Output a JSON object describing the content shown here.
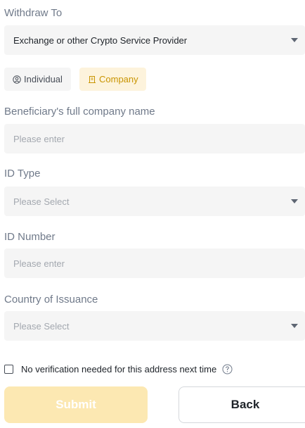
{
  "withdraw_to": {
    "label": "Withdraw To",
    "value": "Exchange or other Crypto Service Provider"
  },
  "recipient_type": {
    "individual_label": "Individual",
    "company_label": "Company",
    "selected": "Company",
    "icons": {
      "individual": "user-circle-icon",
      "company": "building-icon"
    }
  },
  "company_name": {
    "label": "Beneficiary's full company name",
    "placeholder": "Please enter"
  },
  "id_type": {
    "label": "ID Type",
    "placeholder": "Please Select"
  },
  "id_number": {
    "label": "ID Number",
    "placeholder": "Please enter"
  },
  "country": {
    "label": "Country of Issuance",
    "placeholder": "Please Select"
  },
  "no_verification": {
    "label": "No verification needed for this address next time",
    "checked": false,
    "help_icon": "help-circle-icon"
  },
  "buttons": {
    "submit_label": "Submit",
    "back_label": "Back"
  },
  "colors": {
    "accent": "#fcd535",
    "accent_text": "#c99400",
    "field_bg": "#f5f5f5"
  }
}
